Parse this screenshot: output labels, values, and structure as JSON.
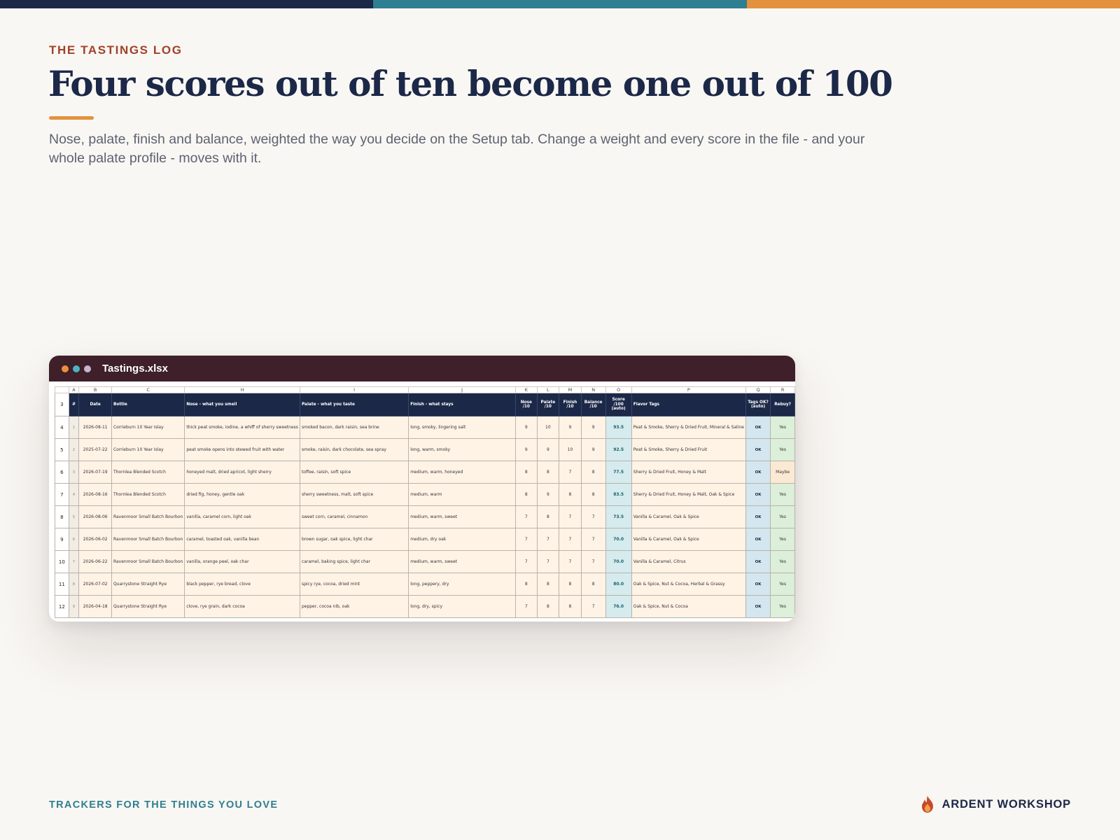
{
  "colors": {
    "navy": "#1c2848",
    "teal": "#2e7f91",
    "orange": "#e4913d",
    "rust": "#a1412a"
  },
  "header": {
    "eyebrow": "THE TASTINGS LOG",
    "title": "Four scores out of ten become one out of 100",
    "subtitle": "Nose, palate, finish and balance, weighted the way you decide on the Setup tab. Change a weight and every score in the file - and your whole palate profile - moves with it."
  },
  "window": {
    "title": "Tastings.xlsx",
    "dot_colors": [
      "#e8913a",
      "#4fb2bf",
      "#c6b5cf"
    ]
  },
  "sheet": {
    "column_letters": [
      "A",
      "B",
      "C",
      "H",
      "I",
      "J",
      "K",
      "L",
      "M",
      "N",
      "O",
      "P",
      "Q",
      "R"
    ],
    "header_row_number": "3",
    "headers": [
      "#",
      "Date",
      "Bottle",
      "Nose - what you smell",
      "Palate - what you taste",
      "Finish - what stays",
      "Nose /10",
      "Palate /10",
      "Finish /10",
      "Balance /10",
      "Score /100 (auto)",
      "Flavor Tags",
      "Tags OK? (auto)",
      "Rebuy?"
    ],
    "rows": [
      {
        "rn": "4",
        "idx": "1",
        "date": "2026-08-11",
        "bottle": "Corrieburn 10 Year Islay",
        "nose": "thick peat smoke, iodine, a whiff of sherry sweetness",
        "palate": "smoked bacon, dark raisin, sea brine",
        "finish": "long, smoky, lingering salt",
        "n": "9",
        "p": "10",
        "f": "9",
        "b": "9",
        "score": "93.5",
        "tags": "Peat & Smoke, Sherry & Dried Fruit, Mineral & Saline",
        "ok": "OK",
        "rebuy": "Yes"
      },
      {
        "rn": "5",
        "idx": "2",
        "date": "2025-07-22",
        "bottle": "Corrieburn 10 Year Islay",
        "nose": "peat smoke opens into stewed fruit with water",
        "palate": "smoke, raisin, dark chocolate, sea spray",
        "finish": "long, warm, smoky",
        "n": "9",
        "p": "9",
        "f": "10",
        "b": "9",
        "score": "92.5",
        "tags": "Peat & Smoke, Sherry & Dried Fruit",
        "ok": "OK",
        "rebuy": "Yes"
      },
      {
        "rn": "6",
        "idx": "3",
        "date": "2026-07-19",
        "bottle": "Thornlea Blended Scotch",
        "nose": "honeyed malt, dried apricot, light sherry",
        "palate": "toffee, raisin, soft spice",
        "finish": "medium, warm, honeyed",
        "n": "8",
        "p": "8",
        "f": "7",
        "b": "8",
        "score": "77.5",
        "tags": "Sherry & Dried Fruit, Honey & Malt",
        "ok": "OK",
        "rebuy": "Maybe"
      },
      {
        "rn": "7",
        "idx": "4",
        "date": "2026-08-16",
        "bottle": "Thornlea Blended Scotch",
        "nose": "dried fig, honey, gentle oak",
        "palate": "sherry sweetness, malt, soft spice",
        "finish": "medium, warm",
        "n": "8",
        "p": "9",
        "f": "8",
        "b": "8",
        "score": "83.5",
        "tags": "Sherry & Dried Fruit, Honey & Malt, Oak & Spice",
        "ok": "OK",
        "rebuy": "Yes"
      },
      {
        "rn": "8",
        "idx": "5",
        "date": "2026-08-06",
        "bottle": "Ravenmoor Small Batch Bourbon",
        "nose": "vanilla, caramel corn, light oak",
        "palate": "sweet corn, caramel, cinnamon",
        "finish": "medium, warm, sweet",
        "n": "7",
        "p": "8",
        "f": "7",
        "b": "7",
        "score": "73.5",
        "tags": "Vanilla & Caramel, Oak & Spice",
        "ok": "OK",
        "rebuy": "Yes"
      },
      {
        "rn": "9",
        "idx": "6",
        "date": "2026-06-02",
        "bottle": "Ravenmoor Small Batch Bourbon",
        "nose": "caramel, toasted oak, vanilla bean",
        "palate": "brown sugar, oak spice, light char",
        "finish": "medium, dry oak",
        "n": "7",
        "p": "7",
        "f": "7",
        "b": "7",
        "score": "70.0",
        "tags": "Vanilla & Caramel, Oak & Spice",
        "ok": "OK",
        "rebuy": "Yes"
      },
      {
        "rn": "10",
        "idx": "7",
        "date": "2026-06-22",
        "bottle": "Ravenmoor Small Batch Bourbon",
        "nose": "vanilla, orange peel, oak char",
        "palate": "caramel, baking spice, light char",
        "finish": "medium, warm, sweet",
        "n": "7",
        "p": "7",
        "f": "7",
        "b": "7",
        "score": "70.0",
        "tags": "Vanilla & Caramel, Citrus",
        "ok": "OK",
        "rebuy": "Yes"
      },
      {
        "rn": "11",
        "idx": "8",
        "date": "2026-07-02",
        "bottle": "Quarrystone Straight Rye",
        "nose": "black pepper, rye bread, clove",
        "palate": "spicy rye, cocoa, dried mint",
        "finish": "long, peppery, dry",
        "n": "8",
        "p": "8",
        "f": "8",
        "b": "8",
        "score": "80.0",
        "tags": "Oak & Spice, Nut & Cocoa, Herbal & Grassy",
        "ok": "OK",
        "rebuy": "Yes"
      },
      {
        "rn": "12",
        "idx": "9",
        "date": "2026-04-18",
        "bottle": "Quarrystone Straight Rye",
        "nose": "clove, rye grain, dark cocoa",
        "palate": "pepper, cocoa nib, oak",
        "finish": "long, dry, spicy",
        "n": "7",
        "p": "8",
        "f": "8",
        "b": "7",
        "score": "76.0",
        "tags": "Oak & Spice, Nut & Cocoa",
        "ok": "OK",
        "rebuy": "Yes"
      }
    ]
  },
  "footer": {
    "tagline": "TRACKERS FOR THE THINGS YOU LOVE",
    "brand": "ARDENT WORKSHOP",
    "brand_icon": "flame-icon"
  }
}
